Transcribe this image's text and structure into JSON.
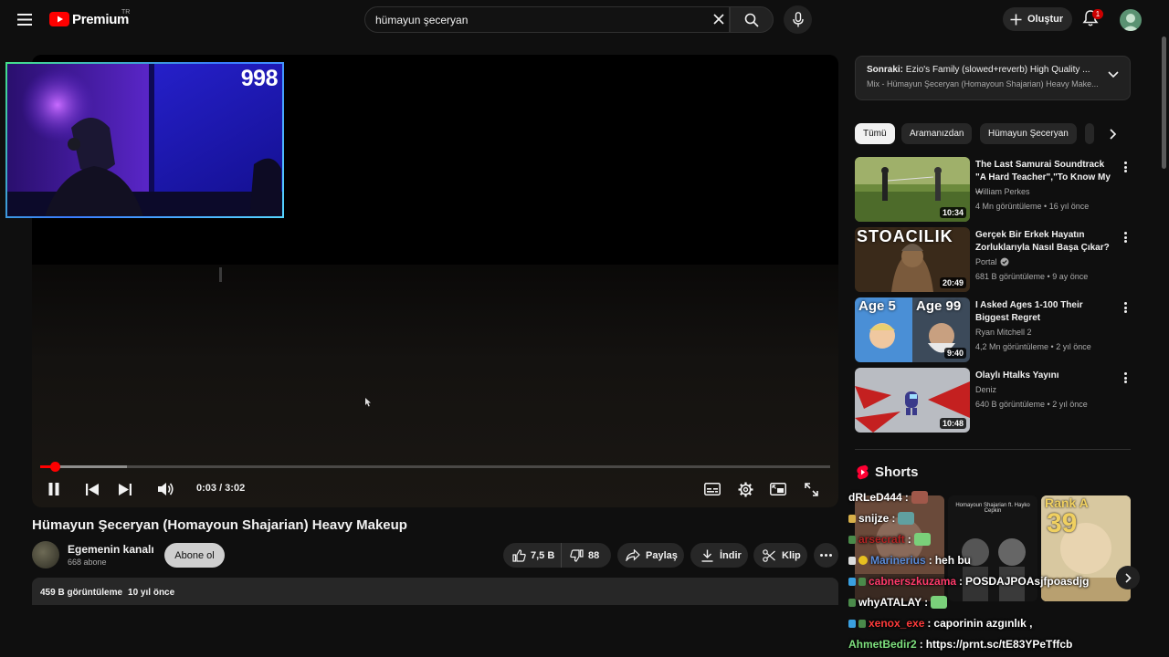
{
  "masthead": {
    "logo_text": "Premium",
    "country_code": "TR",
    "search_value": "hümayun şeceryan",
    "create_label": "Oluştur",
    "notification_count": "1"
  },
  "player": {
    "overlay_counter": "998",
    "time_display": "0:03 / 3:02",
    "progress_played": 0.019,
    "progress_buffered": 0.11
  },
  "video": {
    "title": "Hümayun Şeceryan (Homayoun Shajarian) Heavy Makeup",
    "channel_name": "Egemenin kanalı",
    "subscribers": "668 abone",
    "subscribe_label": "Abone ol",
    "likes": "7,5 B",
    "dislikes": "88",
    "share_label": "Paylaş",
    "download_label": "İndir",
    "clip_label": "Klip",
    "views": "459 B görüntüleme",
    "age": "10 yıl önce"
  },
  "upnext": {
    "prefix": "Sonraki:",
    "title": "Ezio's Family (slowed+reverb) High Quality ...",
    "subtitle": "Mix - Hümayun Şeceryan (Homayoun Shajarian) Heavy Make..."
  },
  "chips": [
    "Tümü",
    "Aramanızdan",
    "Hümayun Şeceryan"
  ],
  "recommendations": [
    {
      "title": "The Last Samurai Soundtrack \"A Hard Teacher\",\"To Know My ...",
      "channel": "William Perkes",
      "meta": "4 Mn görüntüleme • 16 yıl önce",
      "duration": "10:34",
      "verified": false
    },
    {
      "title": "Gerçek Bir Erkek Hayatın Zorluklarıyla Nasıl Başa Çıkar?",
      "channel": "Portal",
      "meta": "681 B görüntüleme • 9 ay önce",
      "duration": "20:49",
      "verified": true,
      "thumb_text": "STOACILIK"
    },
    {
      "title": "I Asked Ages 1-100 Their Biggest Regret",
      "channel": "Ryan Mitchell 2",
      "meta": "4,2 Mn görüntüleme • 2 yıl önce",
      "duration": "9:40",
      "verified": false,
      "thumb_text_left": "Age 5",
      "thumb_text_right": "Age 99"
    },
    {
      "title": "Olaylı Htalks Yayını",
      "channel": "Deniz",
      "meta": "640 B görüntüleme • 2 yıl önce",
      "duration": "10:48",
      "verified": false
    }
  ],
  "shorts": {
    "heading": "Shorts",
    "items": [
      {
        "overlay": ""
      },
      {
        "overlay": "Homayoun Shajarian ft. Hayko Cepkin"
      },
      {
        "overlay": "Rank A",
        "overlay2": "39"
      }
    ]
  },
  "chat": [
    {
      "user": "dRLeD444",
      "message": "",
      "color": "#ffffff"
    },
    {
      "user": "snijze",
      "message": "",
      "color": "#ffffff"
    },
    {
      "user": "arsecraft",
      "message": "",
      "color": "#b22222"
    },
    {
      "user": "Marinerius",
      "message": "heh bu",
      "color": "#5b8bd8"
    },
    {
      "user": "cabnerszkuzama",
      "message": "POSDAJPOAsjfpoasdjg",
      "color": "#ff3b6b"
    },
    {
      "user": "whyATALAY",
      "message": "",
      "color": "#ffffff"
    },
    {
      "user": "xenox_exe",
      "message": "caporinin azgınlık ,",
      "color": "#ff3b3b"
    },
    {
      "user": "AhmetBedir2",
      "message": "https://prnt.sc/tE83YPeTffcb",
      "color": "#7ee07e"
    }
  ],
  "colors": {
    "background": "#0f0f0f",
    "surface": "#272727",
    "accent": "#ff0000",
    "text": "#f1f1f1",
    "secondary_text": "#aaaaaa"
  }
}
